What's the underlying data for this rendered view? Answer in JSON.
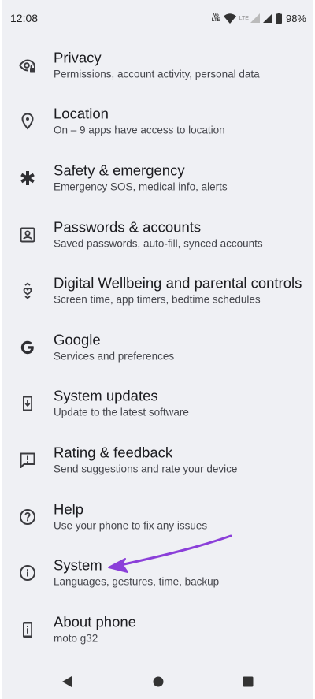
{
  "status_bar": {
    "time": "12:08",
    "volte_line1": "Vo",
    "volte_line2": "LTE",
    "lte_label": "LTE",
    "battery": "98%"
  },
  "settings": [
    {
      "icon": "eye-lock-icon",
      "title": "Privacy",
      "subtitle": "Permissions, account activity, personal data"
    },
    {
      "icon": "location-pin-icon",
      "title": "Location",
      "subtitle": "On – 9 apps have access to location"
    },
    {
      "icon": "asterisk-icon",
      "title": "Safety & emergency",
      "subtitle": "Emergency SOS, medical info, alerts"
    },
    {
      "icon": "account-box-icon",
      "title": "Passwords & accounts",
      "subtitle": "Saved passwords, auto-fill, synced accounts"
    },
    {
      "icon": "wellbeing-icon",
      "title": "Digital Wellbeing and parental controls",
      "subtitle": "Screen time, app timers, bedtime schedules"
    },
    {
      "icon": "google-icon",
      "title": "Google",
      "subtitle": "Services and preferences"
    },
    {
      "icon": "system-update-icon",
      "title": "System updates",
      "subtitle": "Update to the latest software"
    },
    {
      "icon": "feedback-icon",
      "title": "Rating & feedback",
      "subtitle": "Send suggestions and rate your device"
    },
    {
      "icon": "help-icon",
      "title": "Help",
      "subtitle": "Use your phone to fix any issues"
    },
    {
      "icon": "info-icon",
      "title": "System",
      "subtitle": "Languages, gestures, time, backup"
    },
    {
      "icon": "phone-icon",
      "title": "About phone",
      "subtitle": "moto g32"
    }
  ],
  "colors": {
    "background": "#eff0f4",
    "annotation_arrow": "#8b3fd9"
  },
  "nav": {
    "back": "back-icon",
    "home": "home-icon",
    "recents": "recents-icon"
  }
}
